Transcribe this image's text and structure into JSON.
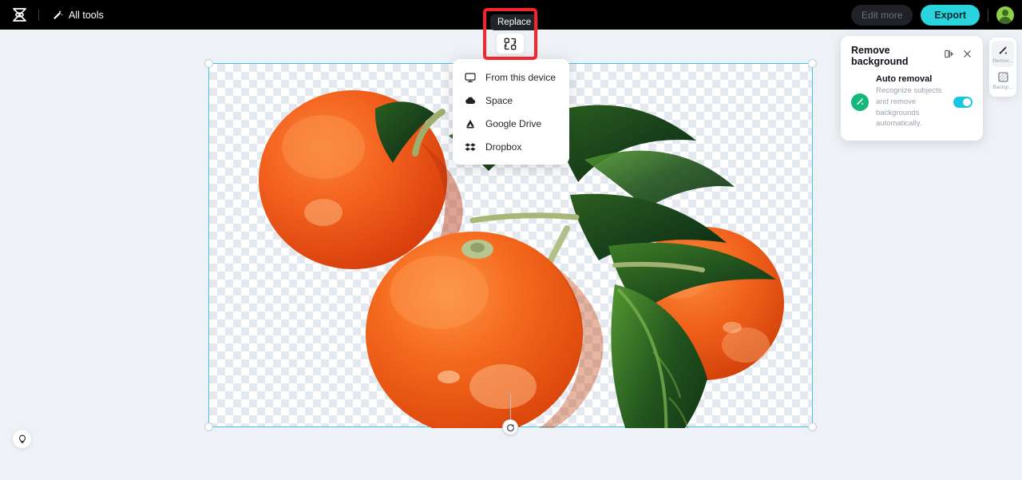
{
  "header": {
    "logo_name": "capcut-logo",
    "all_tools_label": "All tools",
    "edit_more_label": "Edit more",
    "export_label": "Export",
    "avatar_name": "user-avatar"
  },
  "toolbar": {
    "replace_tooltip": "Replace",
    "replace_icon": "replace-swap-icon",
    "highlight_color": "#f5252e"
  },
  "replace_menu": {
    "items": [
      {
        "label": "From this device",
        "icon": "monitor-icon"
      },
      {
        "label": "Space",
        "icon": "cloud-icon"
      },
      {
        "label": "Google Drive",
        "icon": "google-drive-icon"
      },
      {
        "label": "Dropbox",
        "icon": "dropbox-icon"
      }
    ]
  },
  "panel": {
    "title": "Remove background",
    "compare_icon": "compare-split-icon",
    "close_icon": "close-icon",
    "option_title": "Auto removal",
    "option_desc": "Recognize subjects and remove backgrounds automatically.",
    "option_icon": "magic-wand-icon",
    "toggle_state": "on",
    "toggle_color": "#19c6e0",
    "icon_color": "#14b87c"
  },
  "rail": {
    "items": [
      {
        "label": "Remov...",
        "icon": "magic-wand-icon",
        "active": true
      },
      {
        "label": "Backgr...",
        "icon": "checker-square-icon",
        "active": false
      }
    ]
  },
  "canvas": {
    "selection_color": "#3fc6de",
    "rotate_icon": "rotate-icon",
    "artwork_name": "mandarin-oranges-with-leaves",
    "transparency": "checkerboard"
  },
  "help": {
    "icon": "lightbulb-icon"
  }
}
